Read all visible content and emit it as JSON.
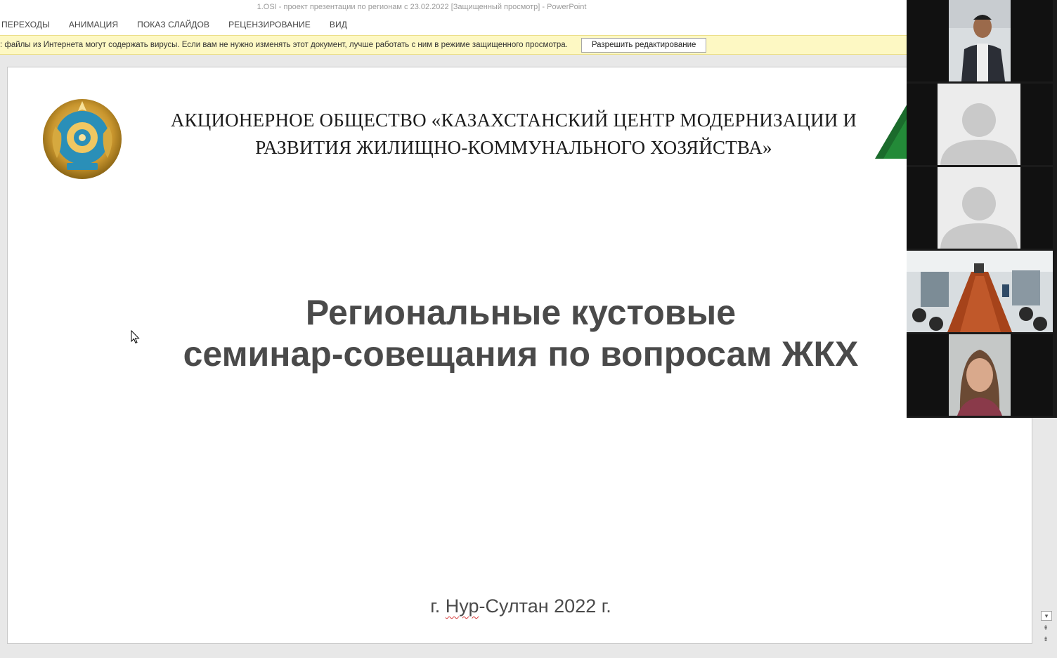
{
  "window": {
    "title": "1.OSI - проект презентации по регионам с 23.02.2022 [Защищенный просмотр] - PowerPoint"
  },
  "ribbon": {
    "tabs": [
      "ПЕРЕХОДЫ",
      "АНИМАЦИЯ",
      "ПОКАЗ СЛАЙДОВ",
      "РЕЦЕНЗИРОВАНИЕ",
      "ВИД"
    ]
  },
  "protected_view": {
    "message": ": файлы из Интернета могут содержать вирусы. Если вам не нужно изменять этот документ, лучше работать с ним в режиме защищенного просмотра.",
    "enable_button": "Разрешить редактирование",
    "bar_color": "#fdf8c3"
  },
  "slide": {
    "org_title_line1": "АКЦИОНЕРНОЕ ОБЩЕСТВО «КАЗАХСТАНСКИЙ ЦЕНТР МОДЕРНИЗАЦИИ И",
    "org_title_line2": "РАЗВИТИЯ ЖИЛИЩНО-КОММУНАЛЬНОГО ХОЗЯЙСТВА»",
    "main_title_line1": "Региональные кустовые",
    "main_title_line2": "семинар-совещания по вопросам ЖКХ",
    "city_prefix": "г.",
    "city_name": "Нур",
    "city_suffix": "-Султан 2022 г.",
    "emblem_icon": "kazakhstan-state-emblem",
    "logo_icon": "green-company-logo",
    "accent_green": "#1b6b2c"
  },
  "video_panel": {
    "participants": [
      {
        "icon": "participant-video-man"
      },
      {
        "icon": "participant-avatar-placeholder"
      },
      {
        "icon": "participant-avatar-placeholder"
      },
      {
        "icon": "participant-video-conference-room"
      },
      {
        "icon": "participant-video-woman"
      }
    ]
  }
}
